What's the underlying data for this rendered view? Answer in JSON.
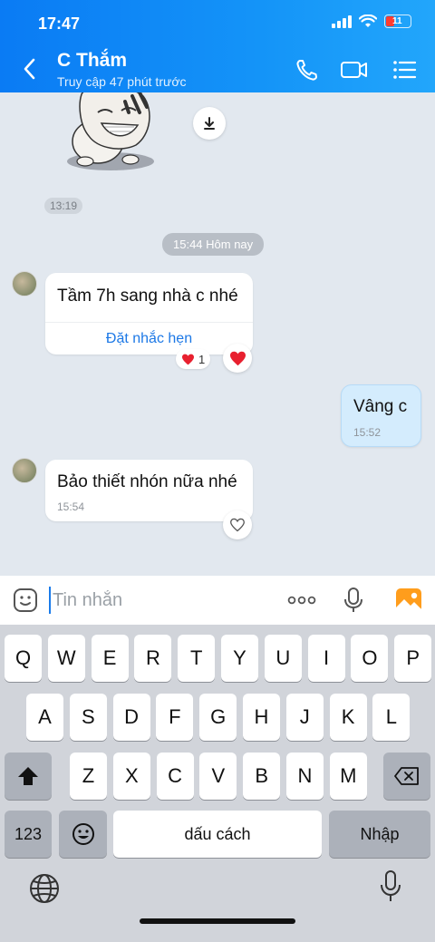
{
  "status_bar": {
    "time": "17:47",
    "battery": "11"
  },
  "header": {
    "contact_name": "C Thắm",
    "contact_status": "Truy cập 47 phút trước",
    "icons": [
      "back-icon",
      "phone-icon",
      "video-icon",
      "menu-icon"
    ]
  },
  "chat": {
    "sticker_time": "13:19",
    "date_separator": "15:44 Hôm nay",
    "messages": [
      {
        "from": "contact",
        "text": "Tầm 7h sang nhà c nhé",
        "action": "Đặt nhắc hẹn",
        "reaction_count": "1"
      },
      {
        "from": "me",
        "text": "Vâng c",
        "time": "15:52"
      },
      {
        "from": "contact",
        "text": "Bảo thiết nhón nữa nhé",
        "time": "15:54"
      }
    ]
  },
  "input": {
    "placeholder": "Tin nhắn"
  },
  "keyboard": {
    "row1": [
      "Q",
      "W",
      "E",
      "R",
      "T",
      "Y",
      "U",
      "I",
      "O",
      "P"
    ],
    "row2": [
      "A",
      "S",
      "D",
      "F",
      "G",
      "H",
      "J",
      "K",
      "L"
    ],
    "row3": [
      "Z",
      "X",
      "C",
      "V",
      "B",
      "N",
      "M"
    ],
    "numbers_key": "123",
    "space_key": "dấu cách",
    "return_key": "Nhập"
  },
  "colors": {
    "header": "#1494f8",
    "link": "#1c78e6",
    "sent_bubble": "#d4ecfd",
    "heart": "#e8202f"
  }
}
